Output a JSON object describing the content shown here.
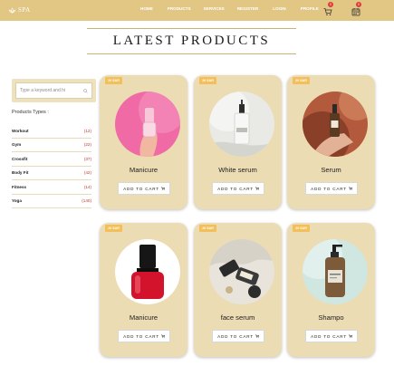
{
  "brand": {
    "logo_text": "SPA"
  },
  "nav": {
    "items": [
      "HOME",
      "PRODUCTS",
      "SERVICES",
      "REGISTER",
      "LOGIN",
      "PROFILE"
    ],
    "cart_count": "0",
    "calendar_count": "0",
    "icons": [
      "cart-icon",
      "calendar-icon"
    ]
  },
  "main": {
    "heading": "LATEST PRODUCTS"
  },
  "sidebar": {
    "search_placeholder": "Type a keyword and hi",
    "types_title": "Products Types :",
    "types": [
      {
        "name": "Workout",
        "count": "(12)"
      },
      {
        "name": "Gym",
        "count": "(22)"
      },
      {
        "name": "Crossfit",
        "count": "(37)"
      },
      {
        "name": "Body Fit",
        "count": "(42)"
      },
      {
        "name": "Fitness",
        "count": "(14)"
      },
      {
        "name": "Yoga",
        "count": "(140)"
      }
    ]
  },
  "products": [
    {
      "sale": "20 SAR",
      "name": "Manicure",
      "button": "ADD TO CART"
    },
    {
      "sale": "20 SAR",
      "name": "White serum",
      "button": "ADD TO CART"
    },
    {
      "sale": "20 SAR",
      "name": "Serum",
      "button": "ADD TO CART"
    },
    {
      "sale": "20 SAR",
      "name": "Manicure",
      "button": "ADD TO CART"
    },
    {
      "sale": "20 SAR",
      "name": "face serum",
      "button": "ADD TO CART"
    },
    {
      "sale": "20 SAR",
      "name": "Shampo",
      "button": "ADD TO CART"
    }
  ],
  "colors": {
    "topbar": "#e2c784",
    "card": "#ecdcb4",
    "sale_badge": "#f3bf5a",
    "count_text": "#c0392b",
    "badge": "#e03b3b"
  }
}
